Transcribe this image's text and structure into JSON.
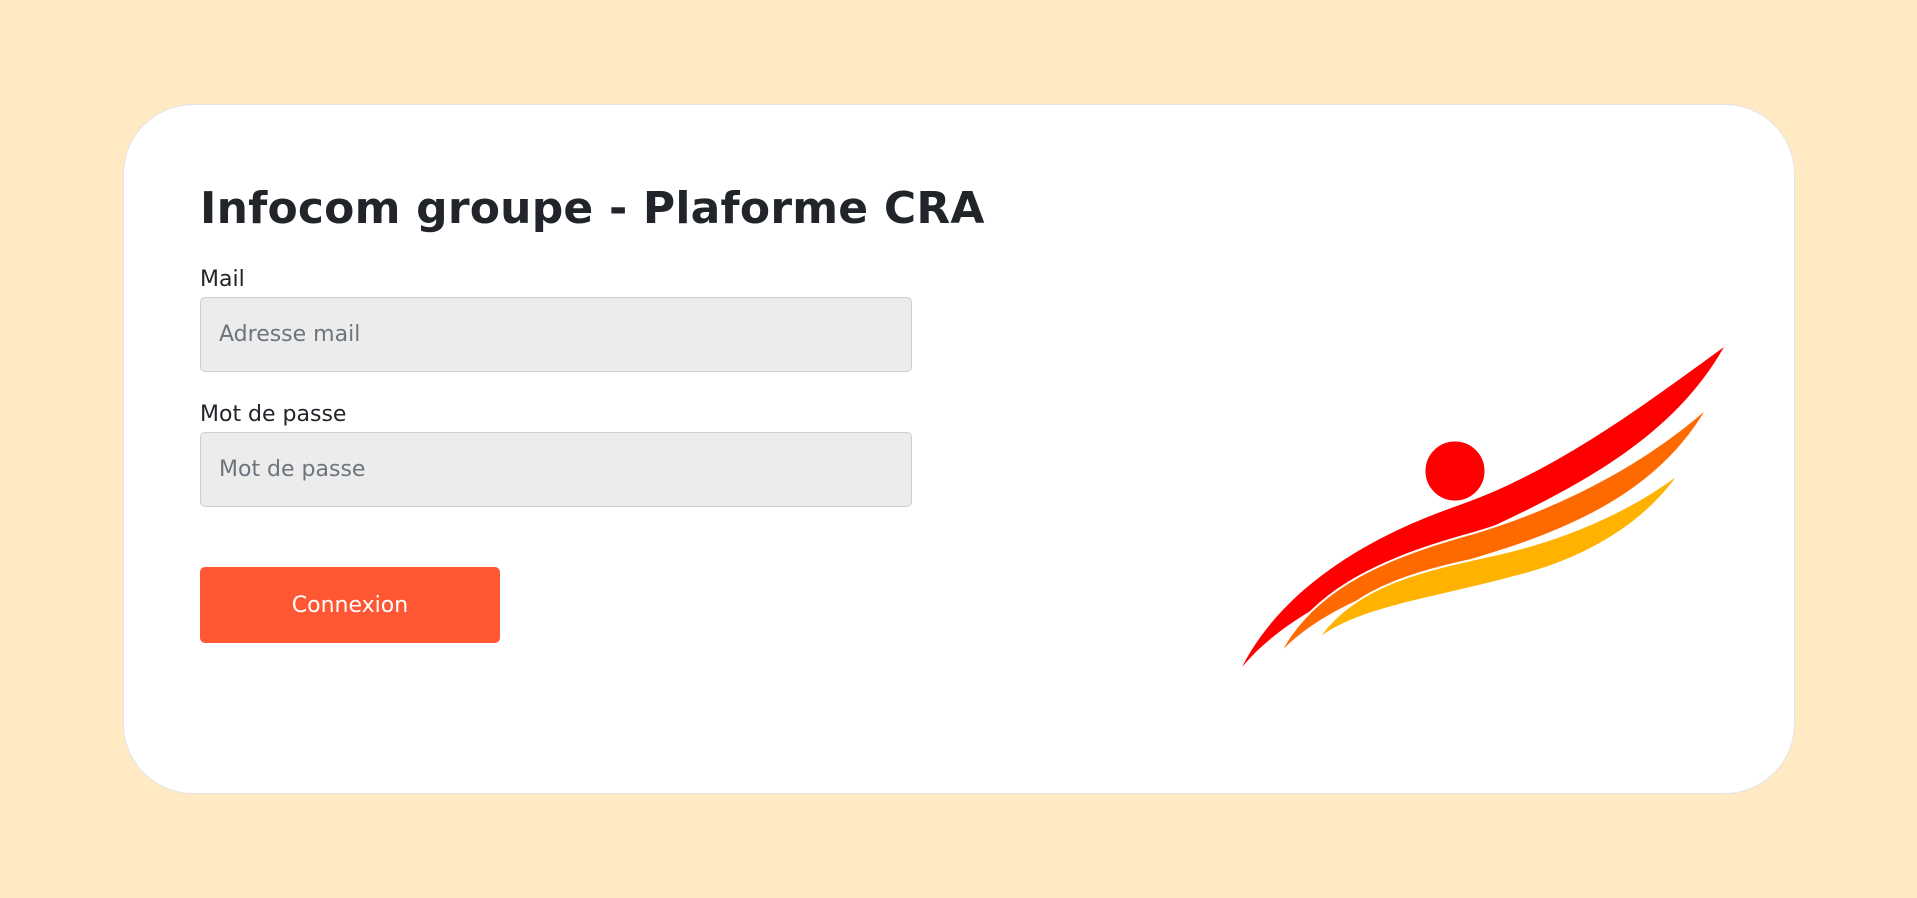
{
  "login": {
    "title": "Infocom groupe - Plaforme CRA",
    "mail_label": "Mail",
    "mail_placeholder": "Adresse mail",
    "password_label": "Mot de passe",
    "password_placeholder": "Mot de passe",
    "submit_label": "Connexion"
  },
  "colors": {
    "page_background": "#ffeac3",
    "accent": "#ff5733",
    "logo_red": "#ff0000",
    "logo_orange": "#ff6a00",
    "logo_yellow": "#ffb300"
  },
  "logo": {
    "icon": "swoosh-figure-logo-icon"
  }
}
